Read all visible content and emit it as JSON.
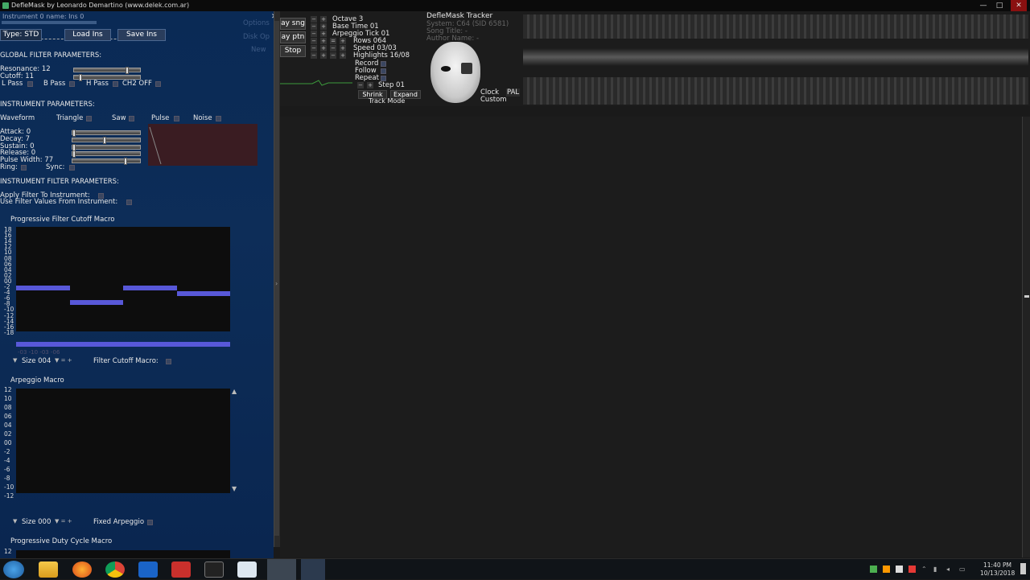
{
  "window": {
    "title": "DefleMask by Leonardo Demartino (www.delek.com.ar)",
    "minimize": "—",
    "maximize": "□",
    "close": "✕"
  },
  "instrument": {
    "name_label": "Instrument 0 name: Ins 0",
    "type_label": "Type: STD",
    "load_button": "Load Ins",
    "save_button": "Save Ins",
    "ghost_options": "Options",
    "ghost_disk": "Disk Op",
    "ghost_new": "New"
  },
  "global_filter": {
    "heading": "GLOBAL FILTER PARAMETERS:",
    "resonance": "Resonance: 12",
    "cutoff": "Cutoff: 11",
    "lpass": "L Pass",
    "bpass": "B Pass",
    "hpass": "H Pass",
    "ch2off": "CH2 OFF"
  },
  "instrument_params": {
    "heading": "INSTRUMENT PARAMETERS:",
    "waveform": "Waveform",
    "triangle": "Triangle",
    "saw": "Saw",
    "pulse": "Pulse",
    "noise": "Noise",
    "attack": "Attack: 0",
    "decay": "Decay: 7",
    "sustain": "Sustain: 0",
    "release": "Release: 0",
    "pulse_width": "Pulse Width: 77",
    "ring": "Ring:",
    "sync": "Sync:"
  },
  "instrument_filter": {
    "heading": "INSTRUMENT FILTER PARAMETERS:",
    "apply": "Apply Filter To Instrument:",
    "use_values": "Use Filter Values From Instrument:"
  },
  "cutoff_macro": {
    "title": "Progressive Filter Cutoff Macro",
    "ticks": [
      "18",
      "16",
      "14",
      "12",
      "10",
      "08",
      "06",
      "04",
      "02",
      "00",
      "-2",
      "-4",
      "-6",
      "-8",
      "-10",
      "-12",
      "-14",
      "-16",
      "-18"
    ],
    "values": [
      -3,
      -8,
      -3,
      -5
    ],
    "range": [
      -18,
      18
    ],
    "below": "-03 -10 -03 -06",
    "size_label": "Size 004",
    "macro_label": "Filter Cutoff Macro:"
  },
  "arp_macro": {
    "title": "Arpeggio Macro",
    "ticks": [
      "12",
      "10",
      "08",
      "06",
      "04",
      "02",
      "00",
      "-2",
      "-4",
      "-6",
      "-8",
      "-10",
      "-12"
    ],
    "size_label": "Size 000",
    "fixed_label": "Fixed Arpeggio"
  },
  "duty_macro": {
    "title": "Progressive Duty Cycle Macro",
    "first_tick": "12"
  },
  "transport": {
    "play_song": "ay sng",
    "play_pattern": "ay ptn",
    "stop": "Stop"
  },
  "settings": {
    "octave": "Octave 3",
    "base_time": "Base Time 01",
    "arp_tick": "Arpeggio Tick 01",
    "rows": "Rows 064",
    "speed": "Speed 03/03",
    "highlights": "Highlights 16/08",
    "record": "Record",
    "follow": "Follow",
    "repeat": "Repeat",
    "step": "Step 01",
    "shrink": "Shrink",
    "expand": "Expand",
    "track_mode": "Track Mode"
  },
  "song": {
    "app_name": "DefleMask Tracker",
    "system": "System: C64 (SID 6581)",
    "song_title": "Song Title: -",
    "author": "Author Name: -",
    "clock": "Clock",
    "pal": "PAL",
    "custom": "Custom"
  },
  "taskbar": {
    "time": "11:40 PM",
    "date": "10/13/2018",
    "apps": [
      "windows-start",
      "file-explorer",
      "firefox",
      "chrome",
      "app-blue",
      "app-red",
      "app-mask",
      "notepad",
      "deflemask",
      "deflemask-2"
    ]
  }
}
